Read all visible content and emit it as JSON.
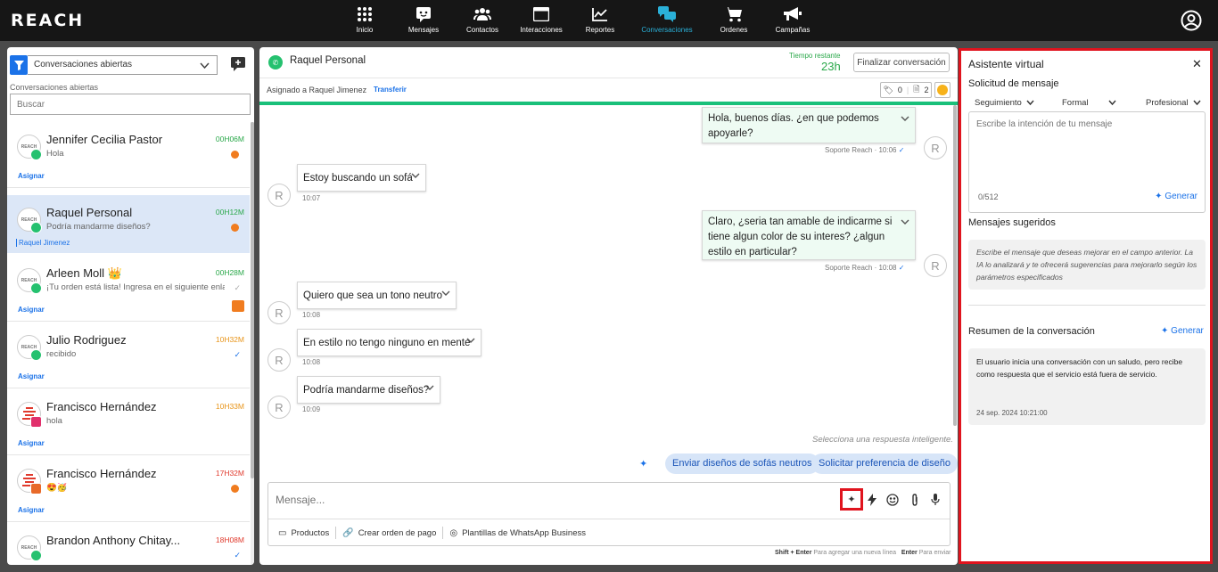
{
  "app": {
    "logo": "REACH"
  },
  "nav": [
    {
      "label": "Inicio",
      "icon": "grid-icon"
    },
    {
      "label": "Mensajes",
      "icon": "chat-icon"
    },
    {
      "label": "Contactos",
      "icon": "people-icon"
    },
    {
      "label": "Interacciones",
      "icon": "window-icon"
    },
    {
      "label": "Reportes",
      "icon": "chart-icon"
    },
    {
      "label": "Conversaciones",
      "icon": "conversations-icon",
      "active": true
    },
    {
      "label": "Ordenes",
      "icon": "cart-icon"
    },
    {
      "label": "Campañas",
      "icon": "megaphone-icon"
    }
  ],
  "left": {
    "filter_value": "Conversaciones abiertas",
    "caption": "Conversaciones abiertas",
    "search_placeholder": "Buscar",
    "conversations": [
      {
        "name": "Jennifer Cecilia Pastor",
        "preview": "Hola",
        "time": "00H06M",
        "assign": "Asignar"
      },
      {
        "name": "Raquel Personal",
        "preview": "Podría mandarme diseños?",
        "time": "00H12M",
        "assigned": "Raquel Jimenez"
      },
      {
        "name": "Arleen Moll 👑",
        "preview": "¡Tu orden está lista! Ingresa en el siguiente enlace",
        "time": "00H28M",
        "assign": "Asignar"
      },
      {
        "name": "Julio Rodriguez",
        "preview": "recibido",
        "time": "10H32M",
        "assign": "Asignar"
      },
      {
        "name": "Francisco Hernández",
        "preview": "hola",
        "time": "10H33M",
        "assign": "Asignar"
      },
      {
        "name": "Francisco Hernández",
        "preview": "😍🥳",
        "time": "17H32M",
        "assign": "Asignar"
      },
      {
        "name": "Brandon Anthony Chitay...",
        "preview": "",
        "time": "18H08M",
        "assign": ""
      }
    ],
    "avatar_text": "REACH"
  },
  "chat": {
    "contact_name": "Raquel Personal",
    "time_left_label": "Tiempo restante",
    "time_left_value": "23h",
    "finalize_label": "Finalizar conversación",
    "assigned_text": "Asignado a Raquel Jimenez",
    "transfer_label": "Transferir",
    "tag_count": "0",
    "note_count": "2",
    "agent_initial": "R",
    "messages": [
      {
        "text": "Hola, buenos días. ¿en que podemos apoyarle?",
        "sender": "Soporte Reach",
        "time": "10:06"
      },
      {
        "text": "Estoy buscando un sofá",
        "time": "10:07"
      },
      {
        "text": "Claro, ¿seria tan amable de indicarme si tiene algun color de su interes? ¿algun estilo en particular?",
        "sender": "Soporte Reach",
        "time": "10:08"
      },
      {
        "text": "Quiero que sea un tono neutro",
        "time": "10:08"
      },
      {
        "text": "En estilo no tengo ninguno en mente",
        "time": "10:08"
      },
      {
        "text": "Podría mandarme diseños?",
        "time": "10:09"
      }
    ],
    "smart_hint": "Selecciona una respuesta inteligente.",
    "suggestions": [
      "Enviar diseños de sofás neutros",
      "Solicitar preferencia de diseño"
    ],
    "composer_placeholder": "Mensaje...",
    "actions": [
      "Productos",
      "Crear orden de pago",
      "Plantillas de WhatsApp Business"
    ],
    "hint_key1": "Shift + Enter",
    "hint_text1": "Para agregar una nueva línea",
    "hint_key2": "Enter",
    "hint_text2": "Para enviar"
  },
  "assistant": {
    "title": "Asistente virtual",
    "request_title": "Solicitud de mensaje",
    "options": [
      "Seguimiento",
      "Formal",
      "Profesional"
    ],
    "intent_placeholder": "Escribe la intención de tu mensaje",
    "char_count": "0/512",
    "generate_label": "Generar",
    "suggested_title": "Mensajes sugeridos",
    "suggested_hint": "Escribe el mensaje que deseas mejorar en el campo anterior. La IA lo analizará y te ofrecerá sugerencias para mejorarlo según los parámetros especificados",
    "summary_title": "Resumen de la conversación",
    "summary_text": "El usuario inicia una conversación con un saludo, pero recibe como respuesta que el servicio está fuera de servicio.",
    "summary_timestamp": "24 sep. 2024 10:21:00"
  },
  "colors": {
    "accent": "#1b72e8",
    "brand_green": "#19c07a",
    "highlight": "#e0141e",
    "active_nav": "#2ab0d8"
  }
}
